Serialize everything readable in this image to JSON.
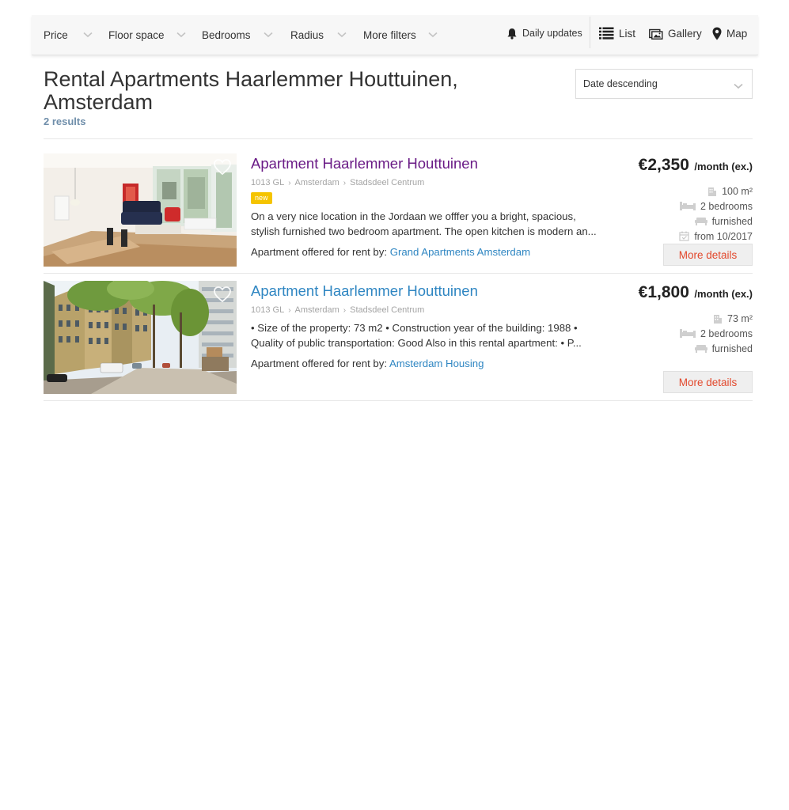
{
  "filters": {
    "price": "Price",
    "floor_space": "Floor space",
    "bedrooms": "Bedrooms",
    "radius": "Radius",
    "more_filters": "More filters"
  },
  "views": {
    "daily_updates": "Daily updates",
    "list": "List",
    "gallery": "Gallery",
    "map": "Map"
  },
  "header": {
    "title": "Rental Apartments Haarlemmer Houttuinen, Amsterdam",
    "result_count": "2 results",
    "sort_value": "Date descending"
  },
  "listings": [
    {
      "title": "Apartment Haarlemmer Houttuinen",
      "postcode": "1013 GL",
      "city": "Amsterdam",
      "district": "Stadsdeel Centrum",
      "badge": "new",
      "desc_line1": "On a very nice location in the Jordaan we offfer you a bright, spacious,",
      "desc_line2": "stylish furnished two bedroom apartment. The open kitchen is modern an...",
      "offered_prefix": "Apartment offered for rent by:",
      "agent": "Grand Apartments Amsterdam",
      "price": "€2,350",
      "price_unit": "/month (ex.)",
      "area": "100 m²",
      "bedrooms": "2 bedrooms",
      "furnished": "furnished",
      "available": "from 10/2017",
      "more": "More details",
      "title_color": "#6a1b86"
    },
    {
      "title": "Apartment Haarlemmer Houttuinen",
      "postcode": "1013 GL",
      "city": "Amsterdam",
      "district": "Stadsdeel Centrum",
      "desc_line1": "• Size of the property: 73 m2 • Construction year of the building: 1988 •",
      "desc_line2": "Quality of public transportation: Good Also in this rental apartment: • P...",
      "offered_prefix": "Apartment offered for rent by:",
      "agent": "Amsterdam Housing",
      "price": "€1,800",
      "price_unit": "/month (ex.)",
      "area": "73 m²",
      "bedrooms": "2 bedrooms",
      "furnished": "furnished",
      "more": "More details",
      "title_color": "#2f86c2"
    }
  ],
  "colors": {
    "link": "#2f86c2",
    "visited": "#6a1b86",
    "accent_red": "#e2482c",
    "badge_yellow": "#f5c400",
    "result_count": "#6f8eaa"
  },
  "icons": [
    "chevron-down-icon",
    "bell-icon",
    "list-icon",
    "gallery-icon",
    "map-pin-icon",
    "heart-icon",
    "building-icon",
    "bed-icon",
    "sofa-icon",
    "calendar-icon"
  ]
}
